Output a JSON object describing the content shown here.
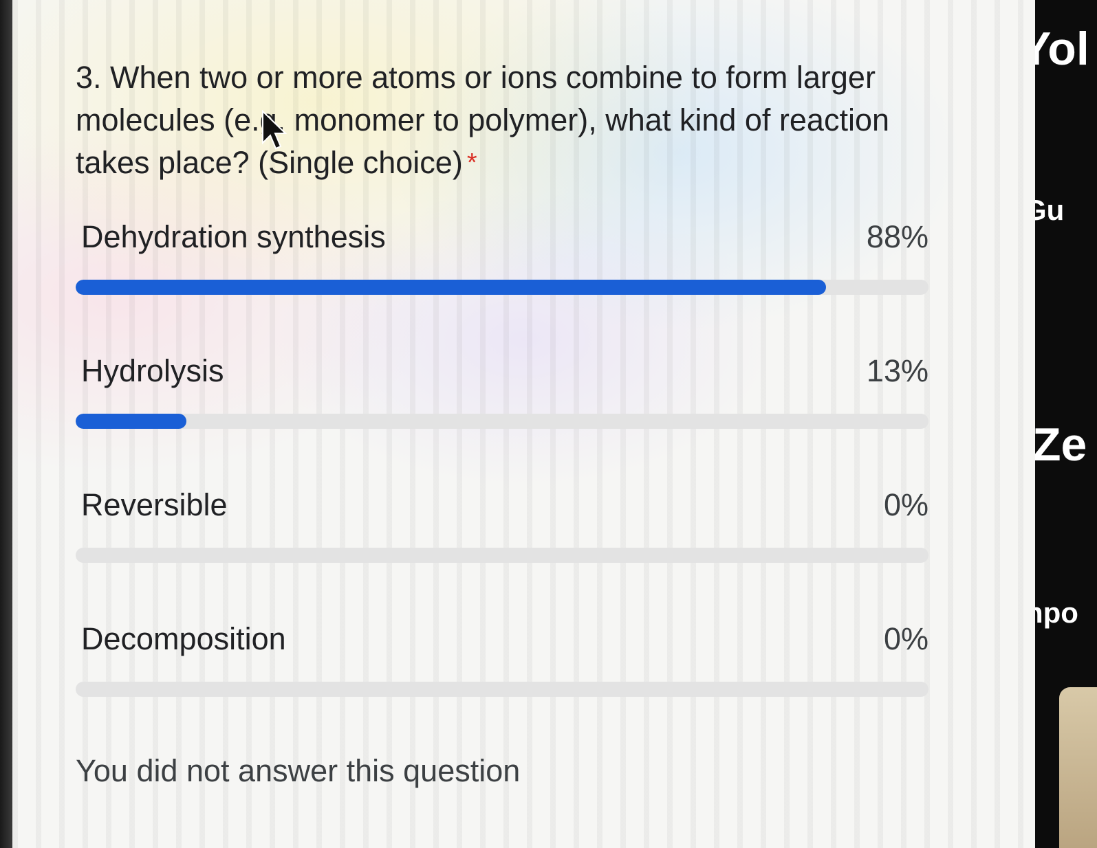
{
  "question": {
    "text": "3. When two or more atoms or ions combine to form larger molecules (e.g. monomer to polymer), what kind of reaction takes place? (Single choice)",
    "required_mark": "*"
  },
  "options": [
    {
      "label": "Dehydration synthesis",
      "percent_text": "88%",
      "percent": 88
    },
    {
      "label": "Hydrolysis",
      "percent_text": "13%",
      "percent": 13
    },
    {
      "label": "Reversible",
      "percent_text": "0%",
      "percent": 0
    },
    {
      "label": "Decomposition",
      "percent_text": "0%",
      "percent": 0
    }
  ],
  "status_note": "You did not answer this question",
  "colors": {
    "bar_fill": "#1a5fd6",
    "bar_track": "#e3e3e3",
    "required": "#d93025"
  },
  "right_panel": {
    "fragments": [
      "Yol",
      "Gu",
      "Ze",
      "npo"
    ]
  },
  "cursor": {
    "icon": "mouse-pointer-icon"
  }
}
